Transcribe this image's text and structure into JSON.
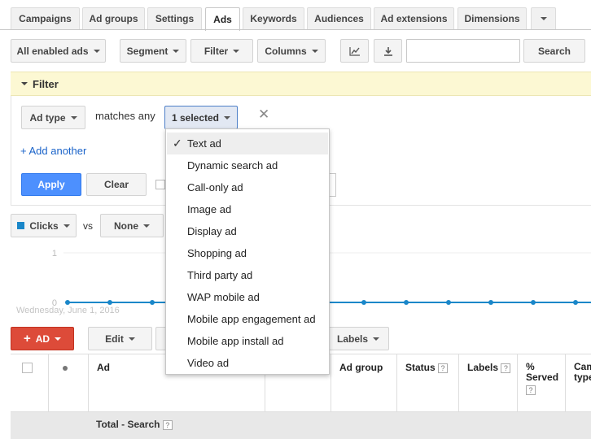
{
  "tabs": [
    "Campaigns",
    "Ad groups",
    "Settings",
    "Ads",
    "Keywords",
    "Audiences",
    "Ad extensions",
    "Dimensions"
  ],
  "toolbar": {
    "status_dropdown": "All enabled ads",
    "segment": "Segment",
    "filter": "Filter",
    "columns": "Columns",
    "search_value": "",
    "search_button": "Search"
  },
  "filter": {
    "title": "Filter",
    "field": "Ad type",
    "operator": "matches any",
    "value": "1 selected",
    "add_another": "+ Add another",
    "apply": "Apply",
    "clear": "Clear"
  },
  "ad_type_menu": {
    "items": [
      "Text ad",
      "Dynamic search ad",
      "Call-only ad",
      "Image ad",
      "Display ad",
      "Shopping ad",
      "Third party ad",
      "WAP mobile ad",
      "Mobile app engagement ad",
      "Mobile app install ad",
      "Video ad"
    ],
    "selected": "Text ad"
  },
  "chart": {
    "metric1": "Clicks",
    "vs": "vs",
    "metric2": "None",
    "date_label": "Wednesday, June 1, 2016",
    "metric1_color": "#1a87c9"
  },
  "chart_data": {
    "type": "line",
    "series": [
      {
        "name": "Clicks",
        "values": [
          0,
          0,
          0,
          0,
          0,
          0,
          0,
          0,
          0,
          0,
          0,
          0,
          0,
          0
        ]
      }
    ],
    "yticks": [
      "0",
      "1"
    ],
    "ylim": [
      0,
      1
    ]
  },
  "actions": {
    "add_ad": "AD",
    "edit": "Edit",
    "labels": "Labels"
  },
  "table": {
    "columns": [
      "Ad",
      "Ad group",
      "Status",
      "Labels",
      "% Served",
      "Cam type"
    ],
    "total_row": "Total - Search"
  },
  "colors": {
    "accent_blue": "#4d90fe",
    "add_red": "#dd4b39",
    "filter_bar": "#fcf8d3"
  }
}
